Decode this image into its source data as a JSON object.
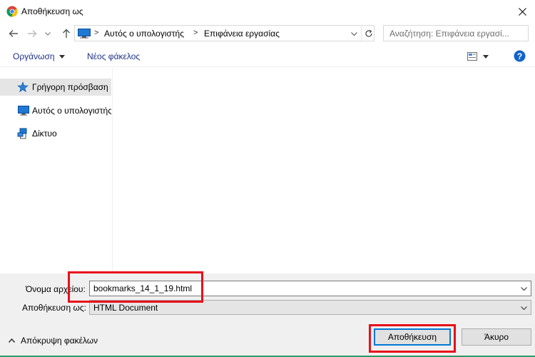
{
  "window": {
    "title": "Αποθήκευση ως"
  },
  "address": {
    "segments": [
      "Αυτός ο υπολογιστής",
      "Επιφάνεια εργασίας"
    ]
  },
  "search": {
    "placeholder": "Αναζήτηση: Επιφάνεια εργασί..."
  },
  "toolbar": {
    "organize_label": "Οργάνωση",
    "new_folder_label": "Νέος φάκελος"
  },
  "sidebar": {
    "items": [
      {
        "label": "Γρήγορη πρόσβαση",
        "icon": "star-icon",
        "selected": true
      },
      {
        "label": "Αυτός ο υπολογιστής",
        "icon": "computer-icon",
        "selected": false
      },
      {
        "label": "Δίκτυο",
        "icon": "network-icon",
        "selected": false
      }
    ]
  },
  "form": {
    "filename_label": "Όνομα αρχείου:",
    "filename_value": "bookmarks_14_1_19.html",
    "savetype_label": "Αποθήκευση ως:",
    "savetype_value": "HTML Document"
  },
  "footer": {
    "hide_folders_label": "Απόκρυψη φακέλων",
    "save_label": "Αποθήκευση",
    "cancel_label": "Άκυρο"
  },
  "colors": {
    "link": "#1e3287",
    "highlight": "#e8101a",
    "accent": "#0078d7"
  }
}
